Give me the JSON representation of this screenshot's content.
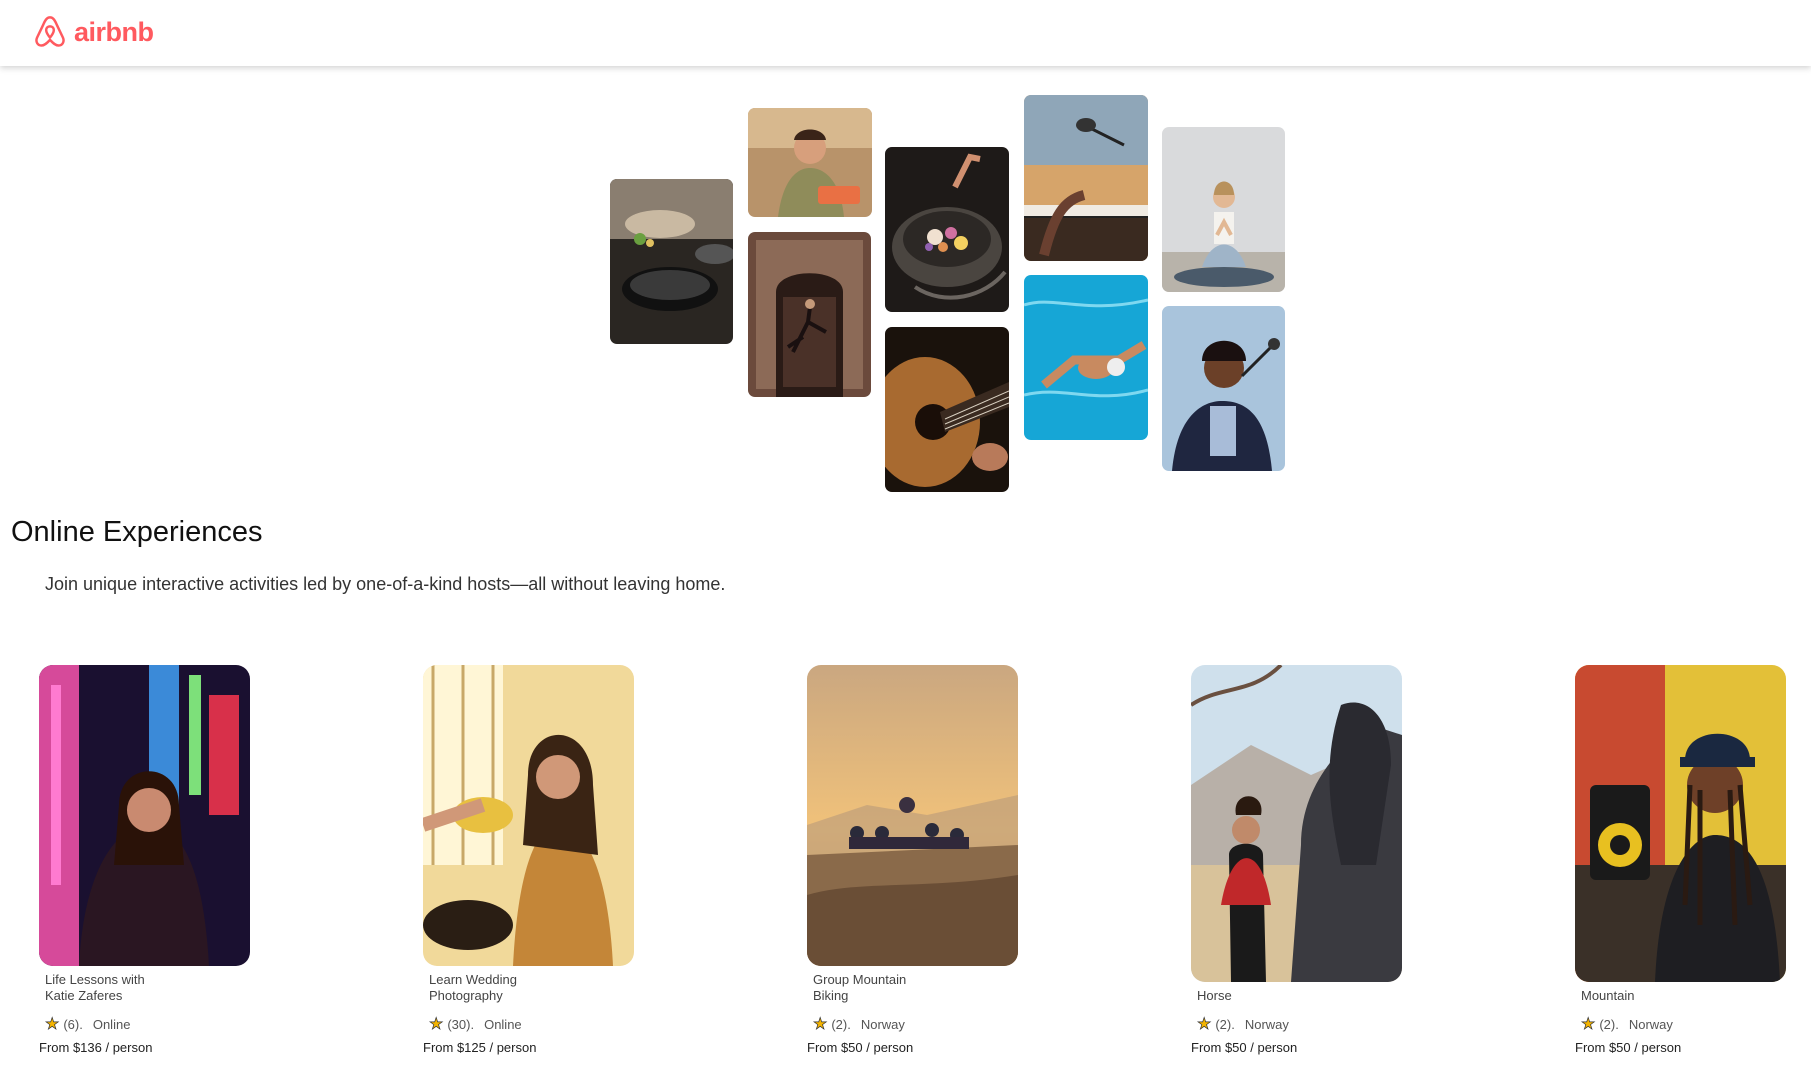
{
  "header": {
    "brand": "airbnb"
  },
  "hero": {
    "tiles": [
      {
        "name": "cooking-pans-photo"
      },
      {
        "name": "chef-woman-photo"
      },
      {
        "name": "dancer-doorway-photo"
      },
      {
        "name": "food-bowl-photo"
      },
      {
        "name": "guitar-photo"
      },
      {
        "name": "piano-microphone-photo"
      },
      {
        "name": "swimmer-photo"
      },
      {
        "name": "yoga-photo"
      },
      {
        "name": "singer-photo"
      }
    ]
  },
  "section": {
    "title": "Online Experiences",
    "subtitle": "Join unique interactive activities led by one-of-a-kind hosts—all without leaving home."
  },
  "cards": [
    {
      "title": "Life Lessons with Katie Zaferes",
      "rating": "(6).",
      "location": "Online",
      "price": "From $136 / person"
    },
    {
      "title": "Learn Wedding Photography",
      "rating": "(30).",
      "location": "Online",
      "price": "From $125 / person"
    },
    {
      "title": "Group Mountain Biking",
      "rating": "(2).",
      "location": "Norway",
      "price": "From $50 / person"
    },
    {
      "title": "Horse",
      "rating": "(2).",
      "location": "Norway",
      "price": "From $50 / person"
    },
    {
      "title": "Mountain",
      "rating": "(2).",
      "location": "Norway",
      "price": "From $50 / person"
    }
  ],
  "colors": {
    "brand": "#FF5A5F",
    "star": "#F4B400"
  }
}
